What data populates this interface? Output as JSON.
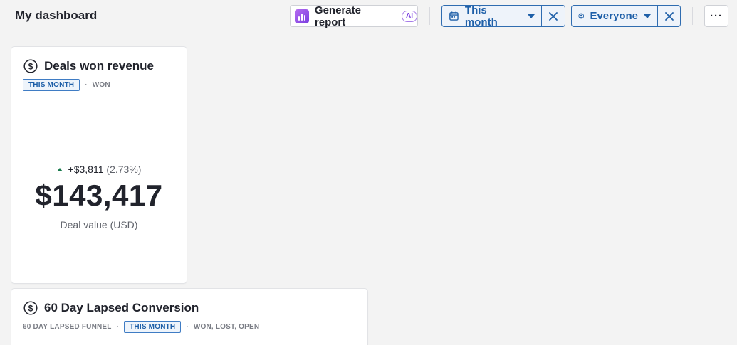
{
  "header": {
    "title": "My dashboard",
    "generate_label": "Generate report",
    "ai_badge": "AI",
    "period_filter": "This month",
    "owner_filter": "Everyone",
    "more_label": "···"
  },
  "cards": [
    {
      "title": "Deals won revenue",
      "period_tag": "THIS MONTH",
      "status_tag": "WON",
      "change": "+$3,811",
      "change_pct": "(2.73%)",
      "value": "$143,417",
      "label": "Deal value (USD)"
    },
    {
      "title": "60 Day Lapsed Conversion",
      "funnel_tag": "60 DAY LAPSED FUNNEL",
      "period_tag": "THIS MONTH",
      "status_tag": "WON, LOST, OPEN"
    }
  ],
  "colors": {
    "accent": "#1e5fa8",
    "positive": "#187a4c",
    "ai_purple": "#7a3ee0"
  },
  "icons": [
    "calendar-icon",
    "person-icon",
    "close-icon",
    "dollar-icon",
    "chart-icon",
    "caret-down-icon",
    "arrow-up-icon"
  ]
}
